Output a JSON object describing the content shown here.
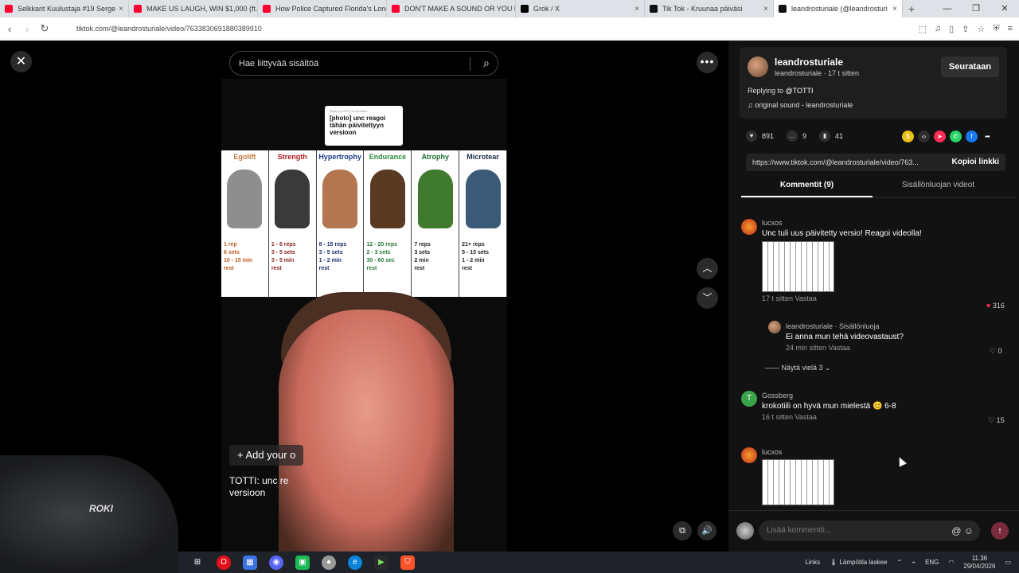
{
  "browser": {
    "tabs": [
      {
        "title": "Selkkarit Kuulustaja #19 Serge",
        "color": "#ff0033"
      },
      {
        "title": "MAKE US LAUGH, WIN $1,000 (ft. St",
        "color": "#ff0033"
      },
      {
        "title": "How Police Captured Florida's Long",
        "color": "#ff0033"
      },
      {
        "title": "DON'T MAKE A SOUND OR YOU DIE",
        "color": "#ff0033"
      },
      {
        "title": "Grok / X",
        "color": "#000000"
      },
      {
        "title": "Tik Tok - Kruunaa päiväsi",
        "color": "#111111"
      },
      {
        "title": "leandrosturiale (@leandrosturi",
        "color": "#111111"
      }
    ],
    "url": "tiktok.com/@leandrosturiale/video/7633830691880389910"
  },
  "player": {
    "search_placeholder": "Hae liittyvää sisältöä",
    "reply_bubble_small": "Reply to TOTTI's comment",
    "reply_bubble_text": "[photo] unc reagoi tähän päivitettyyn versioon",
    "columns": [
      {
        "title": "Egolift",
        "color": "#c47a3d",
        "animal_color": "#8e8e8e",
        "stats": [
          "1 rep",
          "6 sets",
          "10 - 15 min",
          "rest"
        ],
        "stats_color": "#c05a1f"
      },
      {
        "title": "Strength",
        "color": "#b21b1b",
        "animal_color": "#3a3a3a",
        "stats": [
          "1 - 6 reps",
          "3 - 5 sets",
          "3 - 5 min",
          "rest"
        ],
        "stats_color": "#8a1b1b"
      },
      {
        "title": "Hypertrophy",
        "color": "#1a3a8a",
        "animal_color": "#b4764e",
        "stats": [
          "8 - 15 reps",
          "3 - 5 sets",
          "1 - 2 min",
          "rest"
        ],
        "stats_color": "#1a2a6a"
      },
      {
        "title": "Endurance",
        "color": "#2a8a3a",
        "animal_color": "#5a3a22",
        "stats": [
          "12 - 20 reps",
          "2 - 3 sets",
          "30 - 60 sec",
          "rest"
        ],
        "stats_color": "#2a7a3a"
      },
      {
        "title": "Atrophy",
        "color": "#1a6a2a",
        "animal_color": "#3f7a2f",
        "stats": [
          "7 reps",
          "3 sets",
          "2 min",
          "rest"
        ],
        "stats_color": "#222222"
      },
      {
        "title": "Microtear",
        "color": "#1a2a4a",
        "animal_color": "#3b5a78",
        "stats": [
          "21+ reps",
          "5 - 10 sets",
          "1 - 2 min",
          "rest"
        ],
        "stats_color": "#222222"
      }
    ],
    "add_your": "+ Add your o",
    "caption": "TOTTI: unc re versioon"
  },
  "side": {
    "author_name": "leandrosturiale",
    "author_sub": "leandrosturiale · 17 t sitten",
    "follow_label": "Seurataan",
    "replying_prefix": "Replying to",
    "replying_user": "@TOTTI",
    "sound": "♫  original sound - leandrosturiale",
    "likes": "891",
    "comments": "9",
    "saves": "41",
    "link": "https://www.tiktok.com/@leandrosturiale/video/763...",
    "copy_label": "Kopioi linkki",
    "tab_comments": "Kommentit (9)",
    "tab_videos": "Sisällönluojan videot",
    "comments_list": [
      {
        "name": "lucxos",
        "text": "Unc tuli uus päivitetty versio! Reagoi videolla!",
        "meta": "17 t sitten   Vastaa",
        "likes": "316"
      },
      {
        "name": "leandrosturiale · Sisällönluoja",
        "text": "Ei anna mun tehä videovastaust?",
        "meta": "24 min sitten   Vastaa",
        "likes": "0"
      },
      {
        "name": "Gossberg",
        "text": "krokotiili on hyvä mun mielestä 😊 6-8",
        "meta": "16 t sitten   Vastaa",
        "likes": "15"
      },
      {
        "name": "lucxos",
        "text": "",
        "meta": "",
        "likes": ""
      }
    ],
    "show_more": "Näytä vielä 3 ⌄",
    "input_placeholder": "Lisää kommentti..."
  },
  "taskbar": {
    "links": "Links",
    "weather": "Lämpötila laskee",
    "lang": "ENG",
    "time": "11.36",
    "date": "29/04/2026"
  },
  "webcam": {
    "logo": "ROKI"
  }
}
